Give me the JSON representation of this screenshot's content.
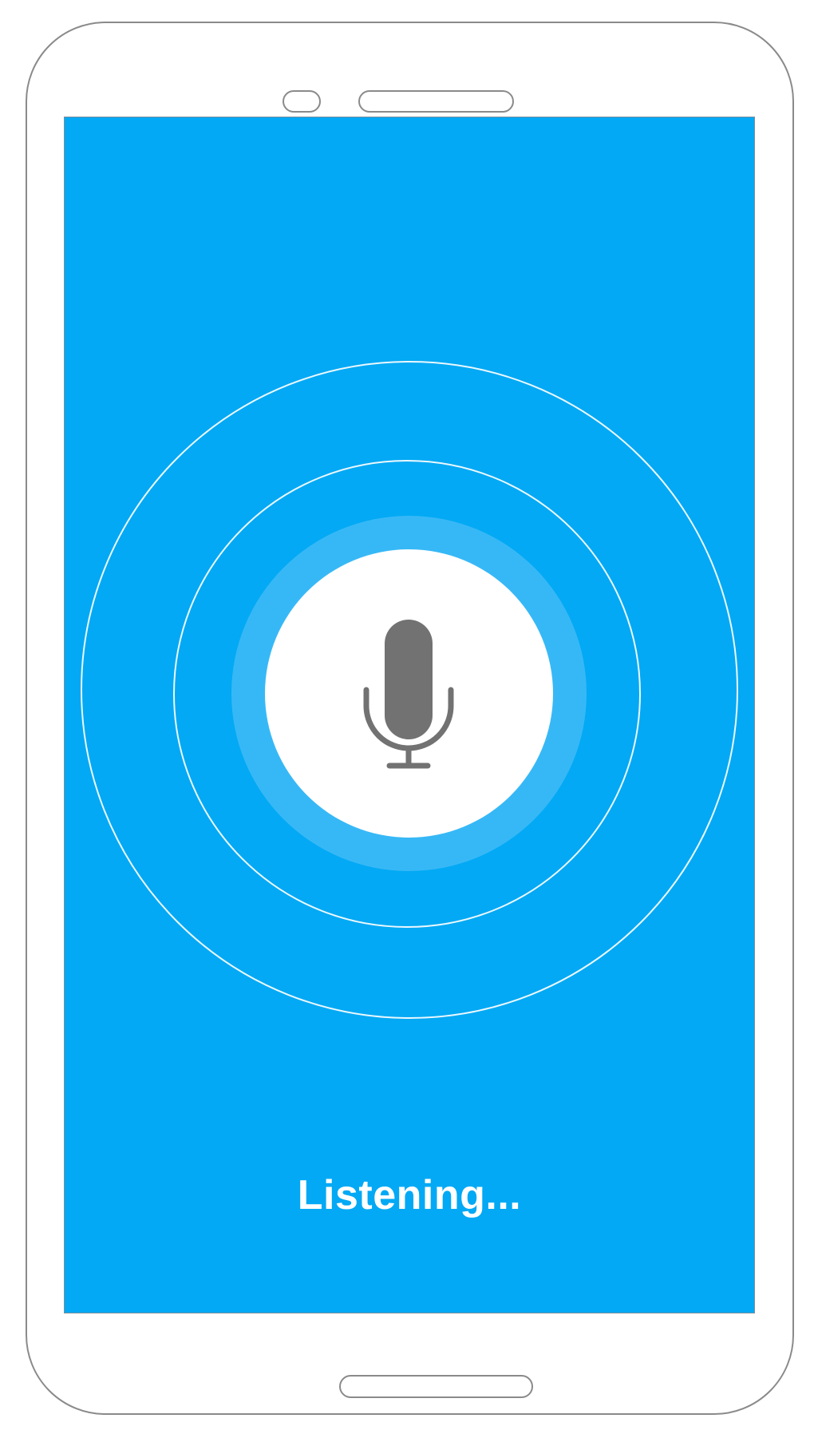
{
  "colors": {
    "screen_background": "#03A9F4",
    "glow_circle": "#37B8F6",
    "mic_button": "#FFFFFF",
    "mic_icon": "#727272",
    "status_text": "#FFFFFF",
    "ring": "#FFFFFF"
  },
  "voice_input": {
    "icon": "microphone-icon",
    "status_text": "Listening..."
  }
}
